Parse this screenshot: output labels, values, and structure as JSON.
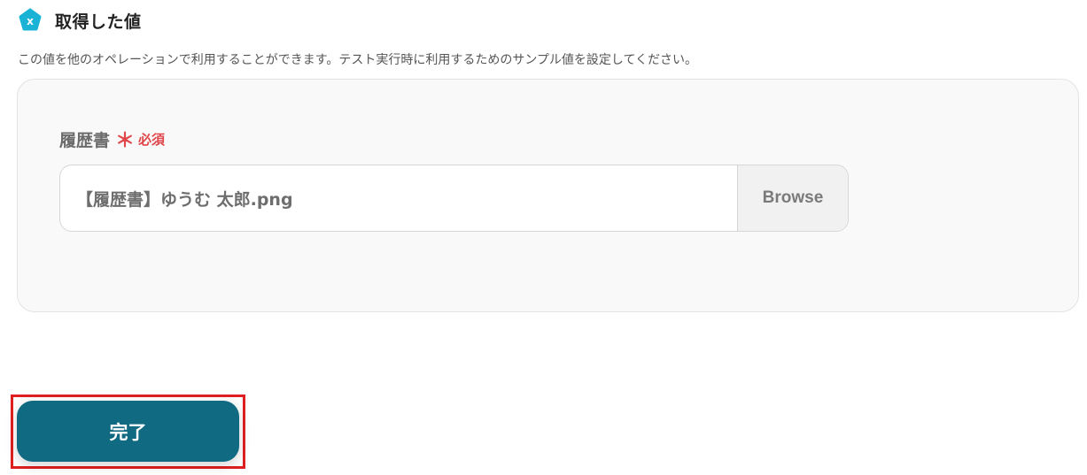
{
  "section": {
    "icon": "x-badge-icon",
    "title": "取得した値",
    "description": "この値を他のオペレーションで利用することができます。テスト実行時に利用するためのサンプル値を設定してください。"
  },
  "field": {
    "label": "履歴書",
    "required_mark": "＊",
    "required_text": "必須",
    "file_name": "【履歴書】ゆうむ 太郎.png",
    "browse_label": "Browse"
  },
  "actions": {
    "done_label": "完了"
  },
  "colors": {
    "accent": "#0f6a82",
    "badge": "#1ab3d6",
    "required": "#e0454a",
    "highlight": "#e02020"
  }
}
